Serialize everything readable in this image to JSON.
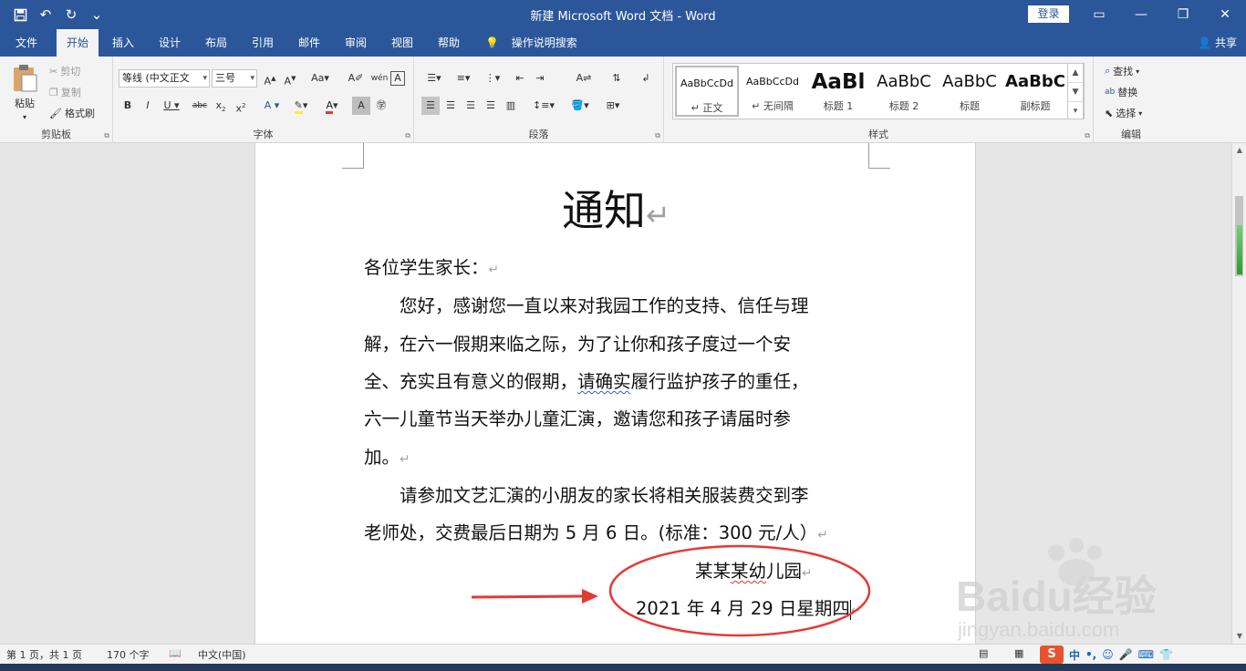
{
  "window": {
    "title": "新建 Microsoft Word 文档 - Word",
    "login_label": "登录",
    "minimize": "—",
    "restore": "❐",
    "close": "✕",
    "ribbon_options": "▭"
  },
  "qat": {
    "save": "💾",
    "undo": "↶",
    "redo": "↻",
    "customize": "⌄"
  },
  "tabs": [
    {
      "label": "文件"
    },
    {
      "label": "开始"
    },
    {
      "label": "插入"
    },
    {
      "label": "设计"
    },
    {
      "label": "布局"
    },
    {
      "label": "引用"
    },
    {
      "label": "邮件"
    },
    {
      "label": "审阅"
    },
    {
      "label": "视图"
    },
    {
      "label": "帮助"
    }
  ],
  "tell_me": "操作说明搜索",
  "share": "共享",
  "ribbon": {
    "clipboard": {
      "label": "剪贴板",
      "paste": "粘贴",
      "cut": "剪切",
      "copy": "复制",
      "format_painter": "格式刷"
    },
    "font": {
      "label": "字体",
      "font_name": "等线 (中文正文",
      "font_size": "三号"
    },
    "paragraph": {
      "label": "段落"
    },
    "styles": {
      "label": "样式",
      "items": [
        {
          "sample": "AaBbCcDd",
          "name": "↵ 正文"
        },
        {
          "sample": "AaBbCcDd",
          "name": "↵ 无间隔"
        },
        {
          "sample": "AaBl",
          "name": "标题 1"
        },
        {
          "sample": "AaBbC",
          "name": "标题 2"
        },
        {
          "sample": "AaBbC",
          "name": "标题"
        },
        {
          "sample": "AaBbC",
          "name": "副标题"
        }
      ]
    },
    "editing": {
      "label": "编辑",
      "find": "查找",
      "replace": "替换",
      "select": "选择"
    }
  },
  "document": {
    "title": "通知",
    "mark": "↵",
    "greeting": "各位学生家长：",
    "p1": [
      "　　您好，感谢您一直以来对我园工作的支持、信任与理",
      "解，在六一假期来临之际，为了让你和孩子度过一个安"
    ],
    "p1_l3_a": "全、充实且有意义的假期，",
    "p1_l3_b": "请确实",
    "p1_l3_c": "履行监护孩子的重任，",
    "p1_l4": "六一儿童节当天举办儿童汇演，邀请您和孩子请届时参",
    "p1_l5": "加。",
    "p2_l1": "　　请参加文艺汇演的小朋友的家长将相关服装费交到李",
    "p2_l2": "老师处，交费最后日期为 5 月 6 日。(标准：300 元/人）",
    "sign_a": "某某",
    "sign_b": "某幼",
    "sign_c": "儿园",
    "date": "2021 年 4 月 29 日星期四"
  },
  "statusbar": {
    "page": "第 1 页，共 1 页",
    "words": "170 个字",
    "language": "中文(中国)"
  },
  "ime": {
    "logo": "S",
    "mode": "中",
    "punct": "•,",
    "emoji": "☺",
    "voice": "🎤",
    "keyboard": "⌨",
    "skin": "👕"
  },
  "watermark": {
    "brand": "Baidu经验",
    "url": "jingyan.baidu.com"
  },
  "colors": {
    "brand": "#2b579a",
    "annotation": "#e53935"
  }
}
